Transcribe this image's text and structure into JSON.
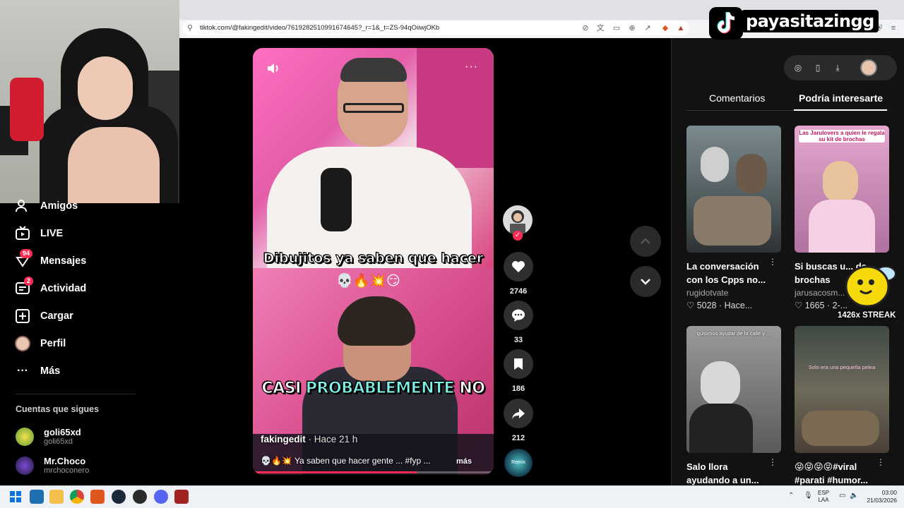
{
  "browser": {
    "url": "tiktok.com/@fakingedit/video/7619282510991674645?_r=1&_t=ZS-94qOiiwjOKb"
  },
  "overlay": {
    "channel_name": "payasitazingg",
    "streak_text": "1426x STREAK"
  },
  "sidebar": {
    "items": [
      {
        "label": "Amigos",
        "icon": "friends-icon"
      },
      {
        "label": "LIVE",
        "icon": "live-icon"
      },
      {
        "label": "Mensajes",
        "icon": "messages-icon",
        "badge": "94"
      },
      {
        "label": "Actividad",
        "icon": "activity-icon",
        "badge": "2"
      },
      {
        "label": "Cargar",
        "icon": "upload-icon"
      },
      {
        "label": "Perfil",
        "icon": "profile-icon"
      },
      {
        "label": "Más",
        "icon": "more-icon"
      }
    ],
    "following_title": "Cuentas que sigues",
    "following": [
      {
        "name": "goli65xd",
        "handle": "goli65xd"
      },
      {
        "name": "Mr.Choco",
        "handle": "mrchoconero"
      }
    ]
  },
  "video": {
    "caption_top": "Dibujitos ya saben que hacer",
    "caption_bottom_1": "CASI ",
    "caption_bottom_2": "PROBABLEMENTE",
    "caption_bottom_3": " NO",
    "emojis": "💀🔥💥😏",
    "author": "fakingedit",
    "time": " · Hace 21 h",
    "description": "💀🔥💥 Ya saben que hacer gente ... #fyp ...",
    "more_label": "más",
    "progress": 0.68
  },
  "actions": {
    "likes": "2746",
    "comments": "33",
    "saves": "186",
    "shares": "212",
    "music_label": "Remix Channel"
  },
  "right_panel": {
    "tabs": [
      "Comentarios",
      "Podría interesarte"
    ],
    "active_tab": 1,
    "cards": [
      {
        "title": "La conversación con los Cpps no...",
        "user": "rugidotvate",
        "likes": "5028",
        "time": "Hace..."
      },
      {
        "title": "Si buscas u... de brochas",
        "user": "jarusacosm...",
        "likes": "1665",
        "time": "2-..."
      },
      {
        "title": "Salo llora ayudando a un...",
        "user": "",
        "likes": "",
        "time": ""
      },
      {
        "title": "😝😝😝😝#viral #parati #humor...",
        "user": "",
        "likes": "",
        "time": ""
      }
    ],
    "thumb_texts": [
      "",
      "Las Jarulovers a quien le regala su kit de brochas",
      "quisimos ayudar de la calle y ...",
      "Solo era una pequeña pelea"
    ]
  },
  "taskbar": {
    "lang_1": "ESP",
    "lang_2": "LAA",
    "time": "03:00",
    "date": "21/03/2026"
  },
  "colors": {
    "accent": "#fe2c55",
    "highlight_caption": "#7ff0e6"
  }
}
